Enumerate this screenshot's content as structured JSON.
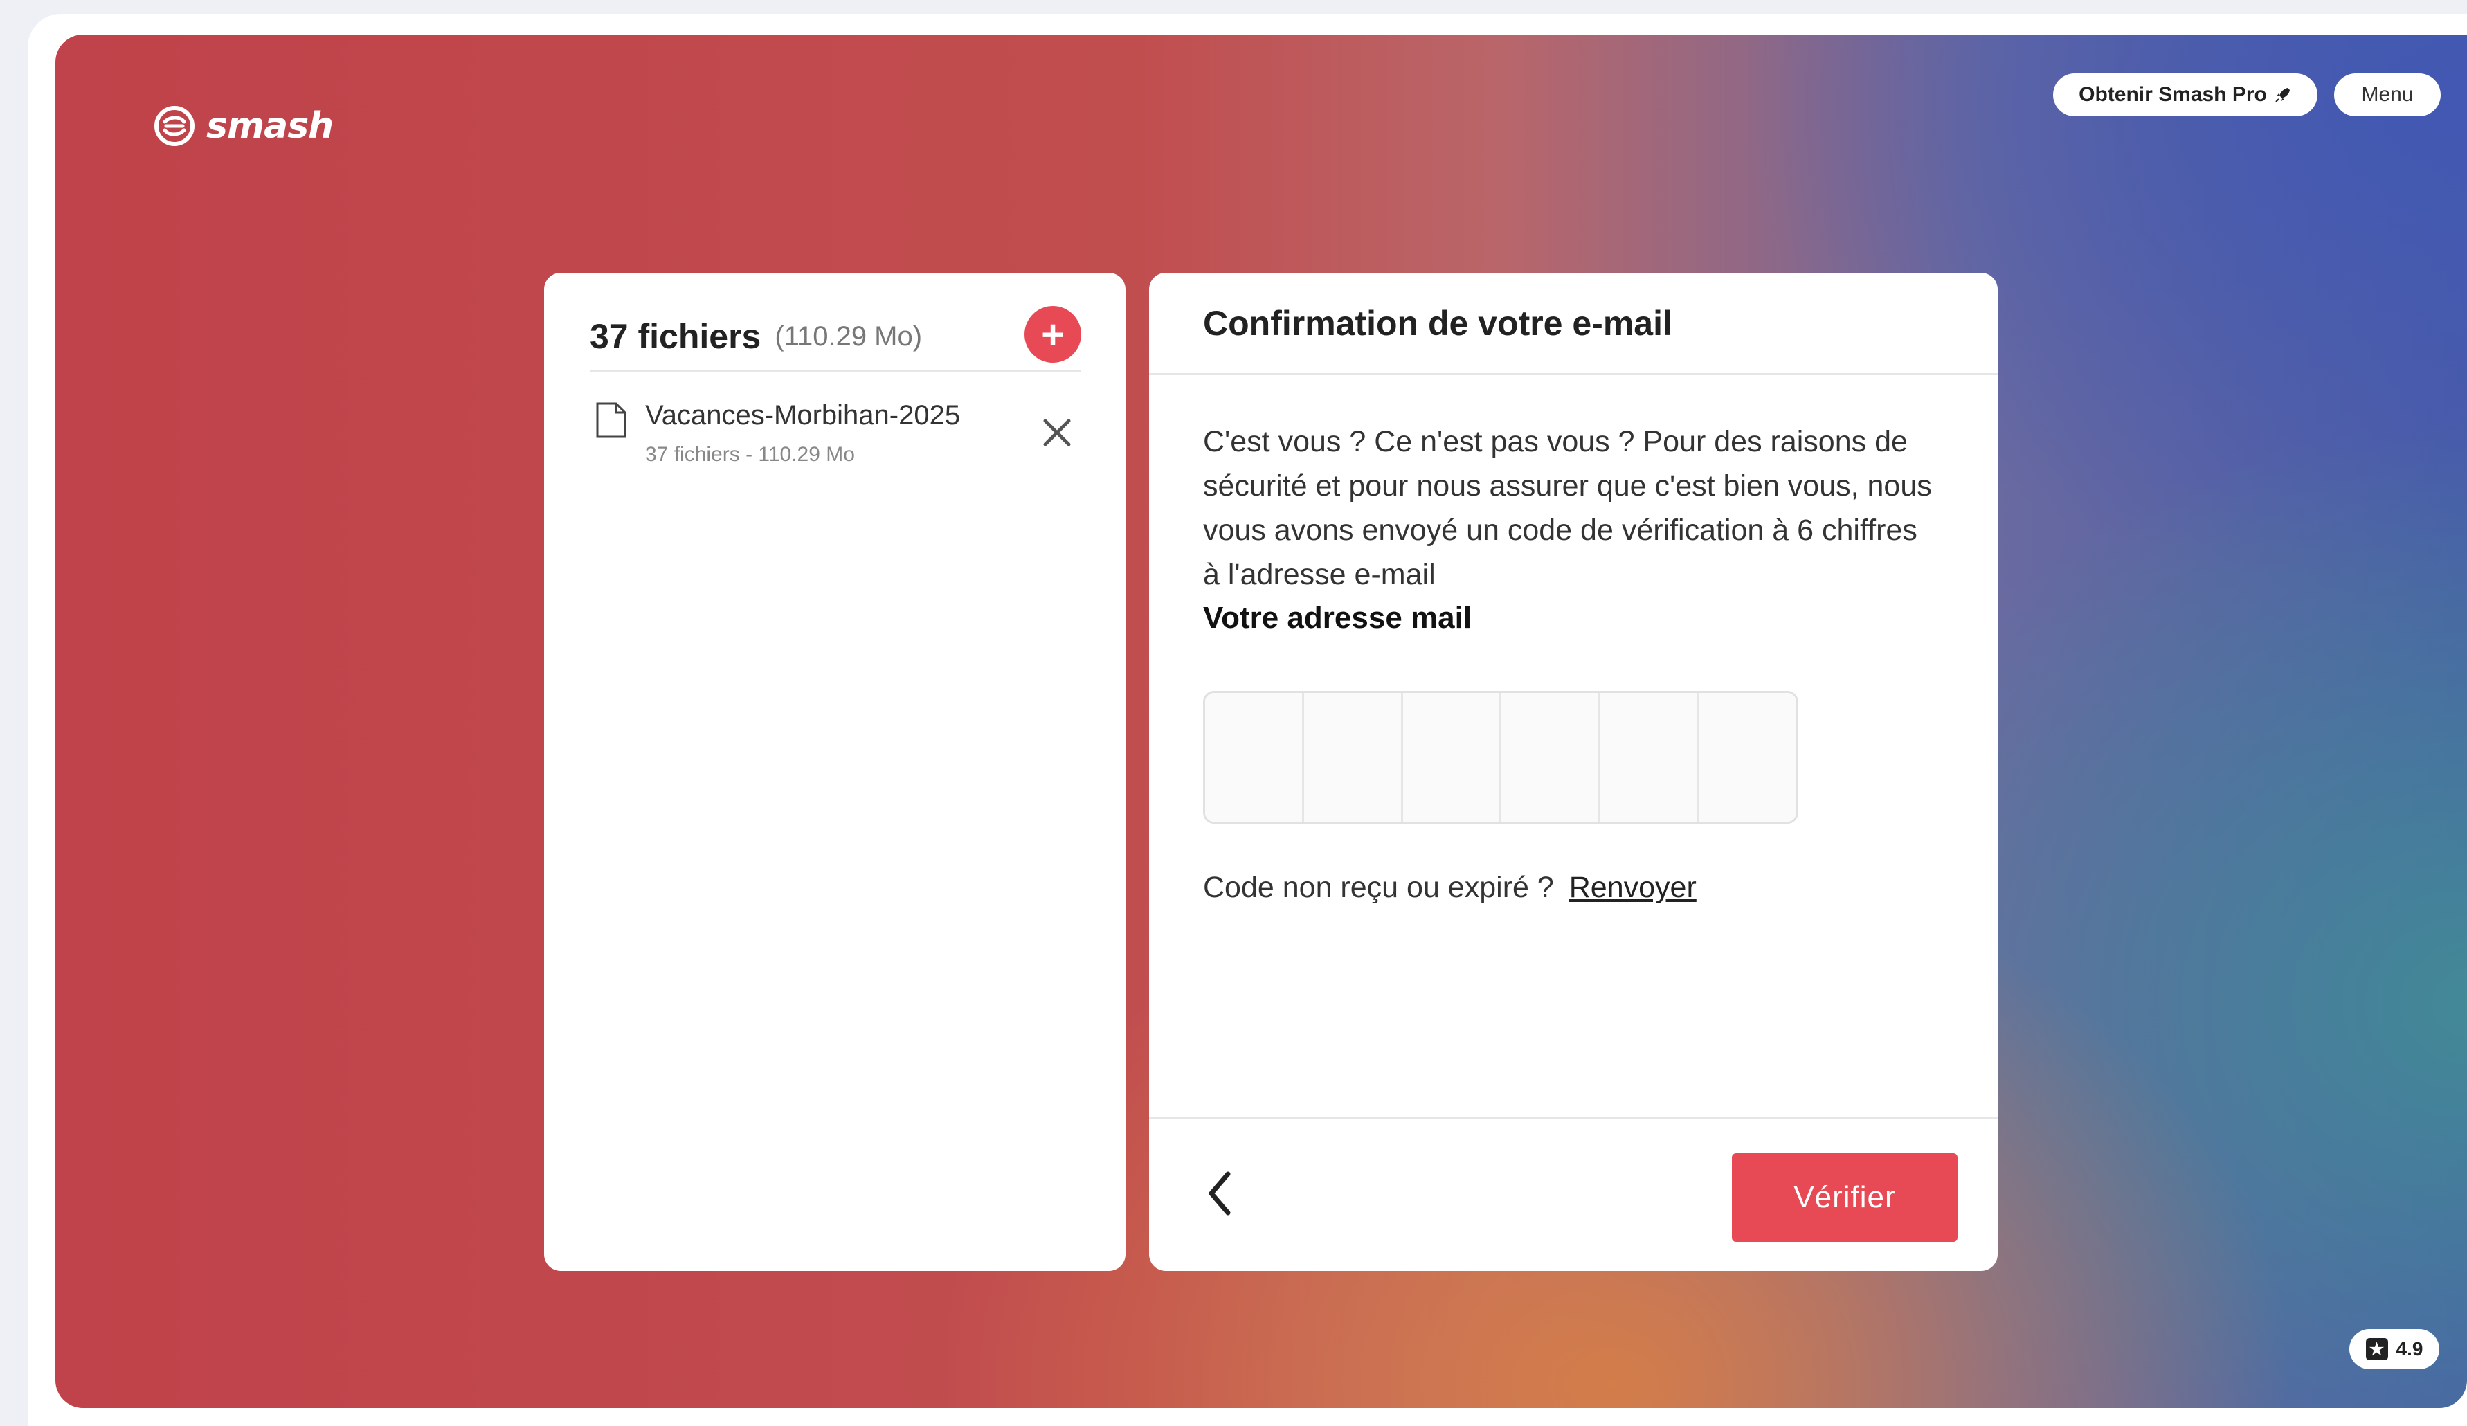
{
  "brand": {
    "name": "smash",
    "logo_icon": "smash-logo-icon"
  },
  "header": {
    "pro_label": "Obtenir Smash Pro",
    "pro_icon": "rocket-icon",
    "menu_label": "Menu"
  },
  "files_panel": {
    "title": "37 fichiers",
    "total_size": "(110.29 Mo)",
    "add_icon": "plus-icon",
    "items": [
      {
        "name": "Vacances-Morbihan-2025",
        "meta": "37 fichiers - 110.29 Mo",
        "icon": "folder-icon"
      }
    ]
  },
  "confirm_panel": {
    "title": "Confirmation de votre e-mail",
    "message": "C'est vous ? Ce n'est pas vous ? Pour des raisons de sécurité et pour nous assurer que c'est bien vous, nous vous avons envoyé un code de vérification à 6 chiffres à l'adresse e-mail",
    "email_label": "Votre adresse mail",
    "code_digits": [
      "",
      "",
      "",
      "",
      "",
      ""
    ],
    "resend_prompt": "Code non reçu ou expiré ?",
    "resend_link": "Renvoyer",
    "verify_label": "Vérifier"
  },
  "rating": {
    "value": "4.9"
  },
  "colors": {
    "accent": "#e84a55"
  }
}
